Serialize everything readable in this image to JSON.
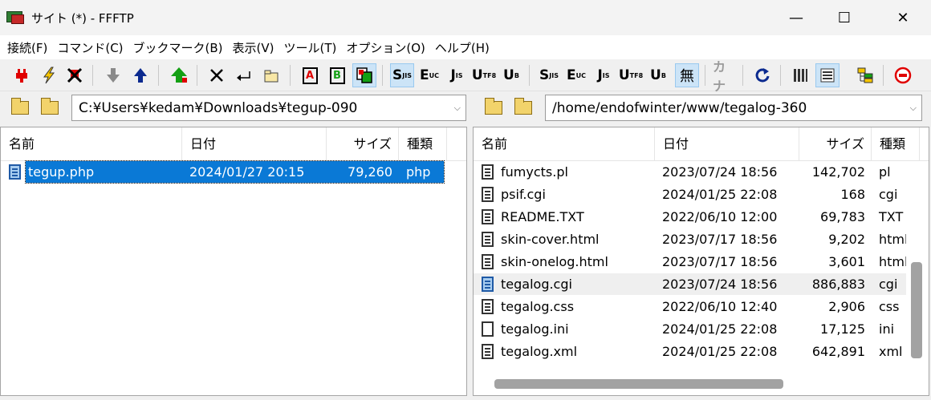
{
  "window": {
    "title": "サイト (*) - FFFTP",
    "minimize": "—",
    "maximize": "☐",
    "close": "✕"
  },
  "menu": [
    "接続(F)",
    "コマンド(C)",
    "ブックマーク(B)",
    "表示(V)",
    "ツール(T)",
    "オプション(O)",
    "ヘルプ(H)"
  ],
  "toolbar": {
    "ascii_mode_label": "A",
    "binary_mode_label": "B",
    "sjis_local": "S",
    "euc_local": "E",
    "jis_local": "J",
    "utf8_local": "U",
    "utf8bom_local": "U",
    "sjis_remote": "S",
    "euc_remote": "E",
    "jis_remote": "J",
    "utf8_remote": "U",
    "utf8bom_remote": "U",
    "no_conversion": "無",
    "kana_conversion": "カナ"
  },
  "local": {
    "path": "C:¥Users¥kedam¥Downloads¥tegup-090",
    "columns": {
      "name": "名前",
      "date": "日付",
      "size": "サイズ",
      "type": "種類"
    },
    "files": [
      {
        "name": "tegup.php",
        "date": "2024/01/27 20:15",
        "size": "79,260",
        "type": "php"
      }
    ]
  },
  "remote": {
    "path": "/home/endofwinter/www/tegalog-360",
    "columns": {
      "name": "名前",
      "date": "日付",
      "size": "サイズ",
      "type": "種類"
    },
    "files": [
      {
        "name": "fumycts.pl",
        "date": "2023/07/24 18:56",
        "size": "142,702",
        "type": "pl"
      },
      {
        "name": "psif.cgi",
        "date": "2024/01/25 22:08",
        "size": "168",
        "type": "cgi"
      },
      {
        "name": "README.TXT",
        "date": "2022/06/10 12:00",
        "size": "69,783",
        "type": "TXT"
      },
      {
        "name": "skin-cover.html",
        "date": "2023/07/17 18:56",
        "size": "9,202",
        "type": "html"
      },
      {
        "name": "skin-onelog.html",
        "date": "2023/07/17 18:56",
        "size": "3,601",
        "type": "html"
      },
      {
        "name": "tegalog.cgi",
        "date": "2023/07/24 18:56",
        "size": "886,883",
        "type": "cgi"
      },
      {
        "name": "tegalog.css",
        "date": "2022/06/10 12:40",
        "size": "2,906",
        "type": "css"
      },
      {
        "name": "tegalog.ini",
        "date": "2024/01/25 22:08",
        "size": "17,125",
        "type": "ini"
      },
      {
        "name": "tegalog.xml",
        "date": "2024/01/25 22:08",
        "size": "642,891",
        "type": "xml"
      }
    ]
  },
  "colors": {
    "selection": "#0a79d6",
    "accent_red": "#e00000",
    "accent_blue": "#0b2a8f",
    "accent_green": "#14a014"
  }
}
